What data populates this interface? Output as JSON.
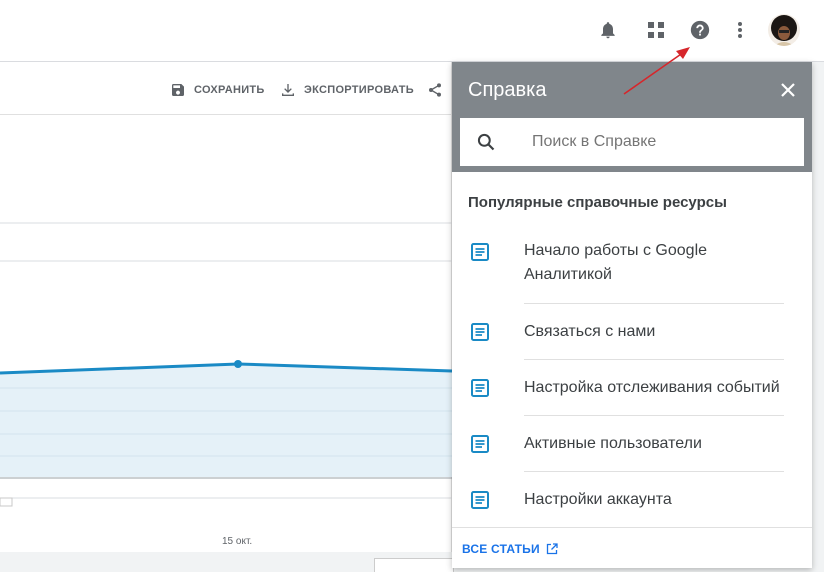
{
  "topbar": {
    "icons": [
      "bell-icon",
      "apps-grid-icon",
      "help-icon",
      "more-vert-icon"
    ]
  },
  "toolbar": {
    "save_label": "СОХРАНИТЬ",
    "export_label": "ЭКСПОРТИРОВАТЬ"
  },
  "chart": {
    "x_tick": "15 окт."
  },
  "help_panel": {
    "title": "Справка",
    "search_placeholder": "Поиск в Справке",
    "section_title": "Популярные справочные ресурсы",
    "resources": [
      {
        "label_line1": "Начало работы с Google",
        "label_line2": "Аналитикой"
      },
      {
        "label_line1": "Связаться с нами"
      },
      {
        "label_line1": "Настройка отслеживания событий"
      },
      {
        "label_line1": "Активные пользователи"
      },
      {
        "label_line1": "Настройки аккаунта"
      }
    ],
    "all_articles_label": "ВСЕ СТАТЬИ"
  },
  "colors": {
    "accent": "#1a73e8",
    "line": "#1a8ac5",
    "area": "#e5f1f8",
    "header": "#80868b",
    "arrow": "#d6262b"
  }
}
